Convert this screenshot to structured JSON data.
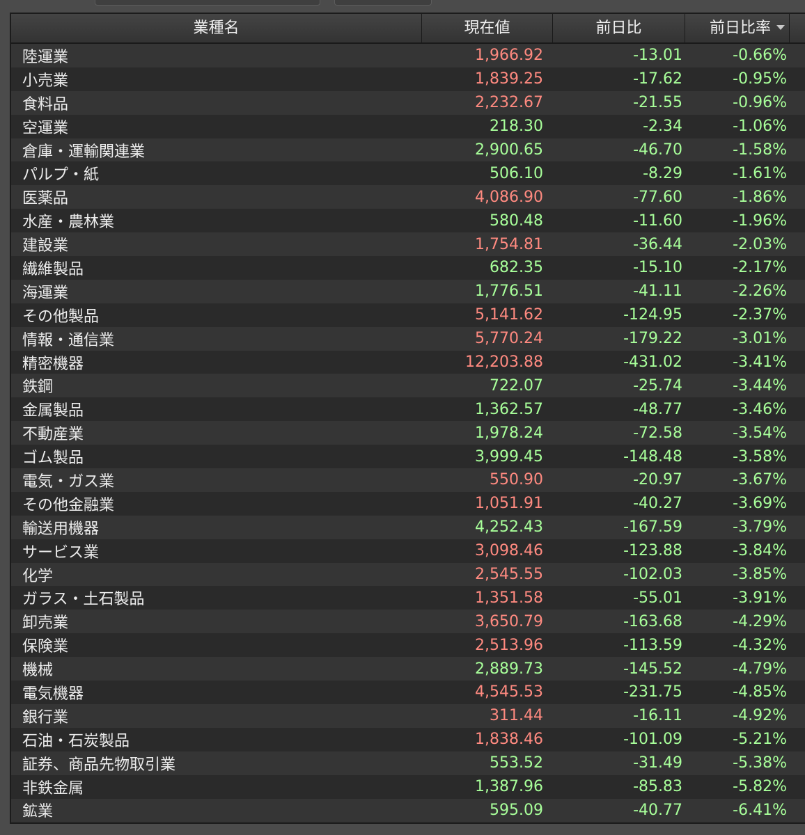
{
  "table": {
    "headers": {
      "name": "業種名",
      "price": "現在値",
      "change": "前日比",
      "rate": "前日比率"
    },
    "colors": {
      "price_up": "#ff8a80",
      "price_down": "#a8ff9a",
      "text": "#ececec",
      "background": "#2f2f2f"
    },
    "sort_indicator_icon": "sort-descending-icon",
    "rows": [
      {
        "name": "陸運業",
        "price": "1,966.92",
        "change": "-13.01",
        "rate": "-0.66%",
        "trend": "up"
      },
      {
        "name": "小売業",
        "price": "1,839.25",
        "change": "-17.62",
        "rate": "-0.95%",
        "trend": "up"
      },
      {
        "name": "食料品",
        "price": "2,232.67",
        "change": "-21.55",
        "rate": "-0.96%",
        "trend": "up"
      },
      {
        "name": "空運業",
        "price": "218.30",
        "change": "-2.34",
        "rate": "-1.06%",
        "trend": "down"
      },
      {
        "name": "倉庫・運輸関連業",
        "price": "2,900.65",
        "change": "-46.70",
        "rate": "-1.58%",
        "trend": "down"
      },
      {
        "name": "パルプ・紙",
        "price": "506.10",
        "change": "-8.29",
        "rate": "-1.61%",
        "trend": "down"
      },
      {
        "name": "医薬品",
        "price": "4,086.90",
        "change": "-77.60",
        "rate": "-1.86%",
        "trend": "up"
      },
      {
        "name": "水産・農林業",
        "price": "580.48",
        "change": "-11.60",
        "rate": "-1.96%",
        "trend": "down"
      },
      {
        "name": "建設業",
        "price": "1,754.81",
        "change": "-36.44",
        "rate": "-2.03%",
        "trend": "up"
      },
      {
        "name": "繊維製品",
        "price": "682.35",
        "change": "-15.10",
        "rate": "-2.17%",
        "trend": "down"
      },
      {
        "name": "海運業",
        "price": "1,776.51",
        "change": "-41.11",
        "rate": "-2.26%",
        "trend": "down"
      },
      {
        "name": "その他製品",
        "price": "5,141.62",
        "change": "-124.95",
        "rate": "-2.37%",
        "trend": "up"
      },
      {
        "name": "情報・通信業",
        "price": "5,770.24",
        "change": "-179.22",
        "rate": "-3.01%",
        "trend": "up"
      },
      {
        "name": "精密機器",
        "price": "12,203.88",
        "change": "-431.02",
        "rate": "-3.41%",
        "trend": "up"
      },
      {
        "name": "鉄鋼",
        "price": "722.07",
        "change": "-25.74",
        "rate": "-3.44%",
        "trend": "down"
      },
      {
        "name": "金属製品",
        "price": "1,362.57",
        "change": "-48.77",
        "rate": "-3.46%",
        "trend": "down"
      },
      {
        "name": "不動産業",
        "price": "1,978.24",
        "change": "-72.58",
        "rate": "-3.54%",
        "trend": "down"
      },
      {
        "name": "ゴム製品",
        "price": "3,999.45",
        "change": "-148.48",
        "rate": "-3.58%",
        "trend": "down"
      },
      {
        "name": "電気・ガス業",
        "price": "550.90",
        "change": "-20.97",
        "rate": "-3.67%",
        "trend": "up"
      },
      {
        "name": "その他金融業",
        "price": "1,051.91",
        "change": "-40.27",
        "rate": "-3.69%",
        "trend": "up"
      },
      {
        "name": "輸送用機器",
        "price": "4,252.43",
        "change": "-167.59",
        "rate": "-3.79%",
        "trend": "down"
      },
      {
        "name": "サービス業",
        "price": "3,098.46",
        "change": "-123.88",
        "rate": "-3.84%",
        "trend": "up"
      },
      {
        "name": "化学",
        "price": "2,545.55",
        "change": "-102.03",
        "rate": "-3.85%",
        "trend": "up"
      },
      {
        "name": "ガラス・土石製品",
        "price": "1,351.58",
        "change": "-55.01",
        "rate": "-3.91%",
        "trend": "up"
      },
      {
        "name": "卸売業",
        "price": "3,650.79",
        "change": "-163.68",
        "rate": "-4.29%",
        "trend": "up"
      },
      {
        "name": "保険業",
        "price": "2,513.96",
        "change": "-113.59",
        "rate": "-4.32%",
        "trend": "up"
      },
      {
        "name": "機械",
        "price": "2,889.73",
        "change": "-145.52",
        "rate": "-4.79%",
        "trend": "down"
      },
      {
        "name": "電気機器",
        "price": "4,545.53",
        "change": "-231.75",
        "rate": "-4.85%",
        "trend": "up"
      },
      {
        "name": "銀行業",
        "price": "311.44",
        "change": "-16.11",
        "rate": "-4.92%",
        "trend": "up"
      },
      {
        "name": "石油・石炭製品",
        "price": "1,838.46",
        "change": "-101.09",
        "rate": "-5.21%",
        "trend": "up"
      },
      {
        "name": "証券、商品先物取引業",
        "price": "553.52",
        "change": "-31.49",
        "rate": "-5.38%",
        "trend": "down"
      },
      {
        "name": "非鉄金属",
        "price": "1,387.96",
        "change": "-85.83",
        "rate": "-5.82%",
        "trend": "down"
      },
      {
        "name": "鉱業",
        "price": "595.09",
        "change": "-40.77",
        "rate": "-6.41%",
        "trend": "down"
      }
    ]
  }
}
